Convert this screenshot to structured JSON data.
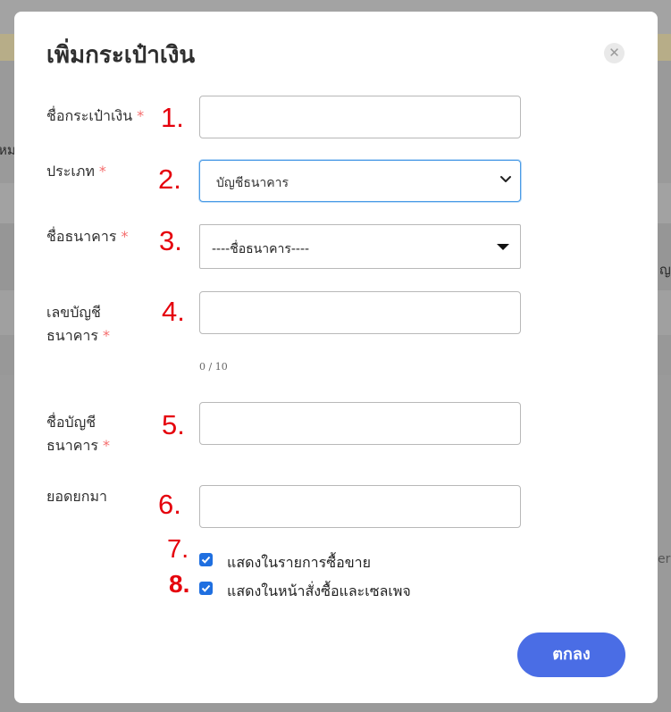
{
  "background": {
    "text_left": "หม",
    "text_right_1": "ญ",
    "text_right_2": "eri"
  },
  "modal": {
    "title": "เพิ่มกระเป๋าเงิน",
    "close_icon": "close-icon",
    "fields": [
      {
        "label": "ชื่อกระเป๋าเงิน",
        "required": "*",
        "number": "1.",
        "value": ""
      },
      {
        "label": "ประเภท",
        "required": "*",
        "number": "2.",
        "value": "บัญชีธนาคาร"
      },
      {
        "label": "ชื่อธนาคาร",
        "required": "*",
        "number": "3.",
        "value": "----ชื่อธนาคาร----"
      },
      {
        "label_line1": "เลขบัญชี",
        "label_line2": "ธนาคาร",
        "required": "*",
        "number": "4.",
        "value": "",
        "counter": "0 / 10"
      },
      {
        "label_line1": "ชื่อบัญชี",
        "label_line2": "ธนาคาร",
        "required": "*",
        "number": "5.",
        "value": ""
      },
      {
        "label": "ยอดยกมา",
        "number": "6.",
        "value": ""
      }
    ],
    "checkboxes": [
      {
        "number": "7.",
        "label": "แสดงในรายการซื้อขาย",
        "checked": true
      },
      {
        "number": "8.",
        "label": "แสดงในหน้าสั่งซื้อและเซลเพจ",
        "checked": true
      }
    ],
    "ok_label": "ตกลง"
  },
  "colors": {
    "accent": "#4a6de5",
    "required": "#f56c6c",
    "annotation": "#e5000c",
    "checkbox": "#1f6fe0"
  }
}
